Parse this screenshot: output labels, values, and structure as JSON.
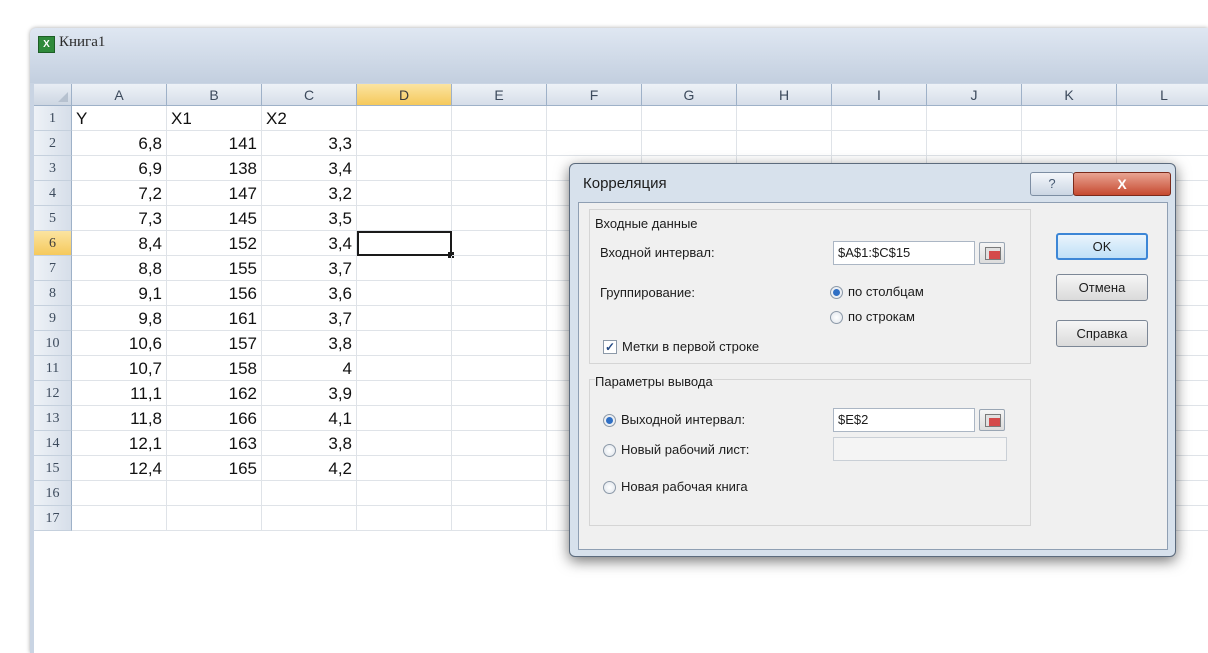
{
  "window": {
    "title": "Книга1",
    "icon": "excel-workbook-icon"
  },
  "columns": [
    "A",
    "B",
    "C",
    "D",
    "E",
    "F",
    "G",
    "H",
    "I",
    "J",
    "K",
    "L"
  ],
  "selected_column": "D",
  "selected_row": "6",
  "rows": [
    "1",
    "2",
    "3",
    "4",
    "5",
    "6",
    "7",
    "8",
    "9",
    "10",
    "11",
    "12",
    "13",
    "14",
    "15",
    "16",
    "17"
  ],
  "sheet": {
    "headers": [
      "Y",
      "X1",
      "X2"
    ],
    "data": [
      [
        "6,8",
        "141",
        "3,3"
      ],
      [
        "6,9",
        "138",
        "3,4"
      ],
      [
        "7,2",
        "147",
        "3,2"
      ],
      [
        "7,3",
        "145",
        "3,5"
      ],
      [
        "8,4",
        "152",
        "3,4"
      ],
      [
        "8,8",
        "155",
        "3,7"
      ],
      [
        "9,1",
        "156",
        "3,6"
      ],
      [
        "9,8",
        "161",
        "3,7"
      ],
      [
        "10,6",
        "157",
        "3,8"
      ],
      [
        "10,7",
        "158",
        "4"
      ],
      [
        "11,1",
        "162",
        "3,9"
      ],
      [
        "11,8",
        "166",
        "4,1"
      ],
      [
        "12,1",
        "163",
        "3,8"
      ],
      [
        "12,4",
        "165",
        "4,2"
      ]
    ]
  },
  "dialog": {
    "title": "Корреляция",
    "help_glyph": "?",
    "close_glyph": "X",
    "input_group": {
      "legend": "Входные данные",
      "range_label": "Входной интервал:",
      "range_value": "$A$1:$C$15",
      "grouping_label": "Группирование:",
      "by_columns": "по столбцам",
      "by_rows": "по строкам",
      "grouping_selected": "по столбцам",
      "labels_checkbox": "Метки в первой строке",
      "labels_checked": true
    },
    "output_group": {
      "legend": "Параметры вывода",
      "output_range": "Выходной интервал:",
      "output_range_value": "$E$2",
      "new_sheet": "Новый рабочий лист:",
      "new_sheet_value": "",
      "new_workbook": "Новая рабочая книга",
      "selected": "Выходной интервал:"
    },
    "buttons": {
      "ok": "OK",
      "cancel": "Отмена",
      "help": "Справка"
    }
  }
}
